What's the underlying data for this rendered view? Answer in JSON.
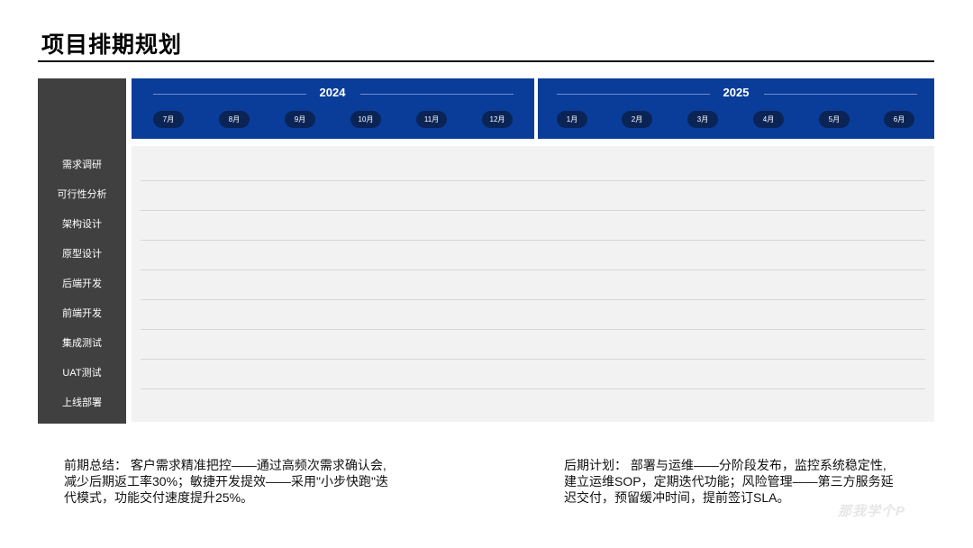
{
  "title": "项目排期规划",
  "years": [
    {
      "label": "2024",
      "months": [
        "7月",
        "8月",
        "9月",
        "10月",
        "11月",
        "12月"
      ]
    },
    {
      "label": "2025",
      "months": [
        "1月",
        "2月",
        "3月",
        "4月",
        "5月",
        "6月"
      ]
    }
  ],
  "tasks": [
    "需求调研",
    "可行性分析",
    "架构设计",
    "原型设计",
    "后端开发",
    "前端开发",
    "集成测试",
    "UAT测试",
    "上线部署"
  ],
  "notes": {
    "left": [
      "前期总结： 客户需求精准把控——通过高频次需求确认会,",
      "减少后期返工率30%；敏捷开发提效——采用\"小步快跑\"迭",
      "代模式，功能交付速度提升25%。"
    ],
    "right": [
      "后期计划： 部署与运维——分阶段发布，监控系统稳定性,",
      "建立运维SOP，定期迭代功能；风险管理——第三方服务延",
      "迟交付，预留缓冲时间，提前签订SLA。"
    ]
  },
  "watermark": "那我学个P",
  "colors": {
    "header_blue": "#0a3d9a",
    "month_pill": "#0b2456",
    "sidebar": "#404040",
    "grid_bg": "#f2f2f2"
  }
}
